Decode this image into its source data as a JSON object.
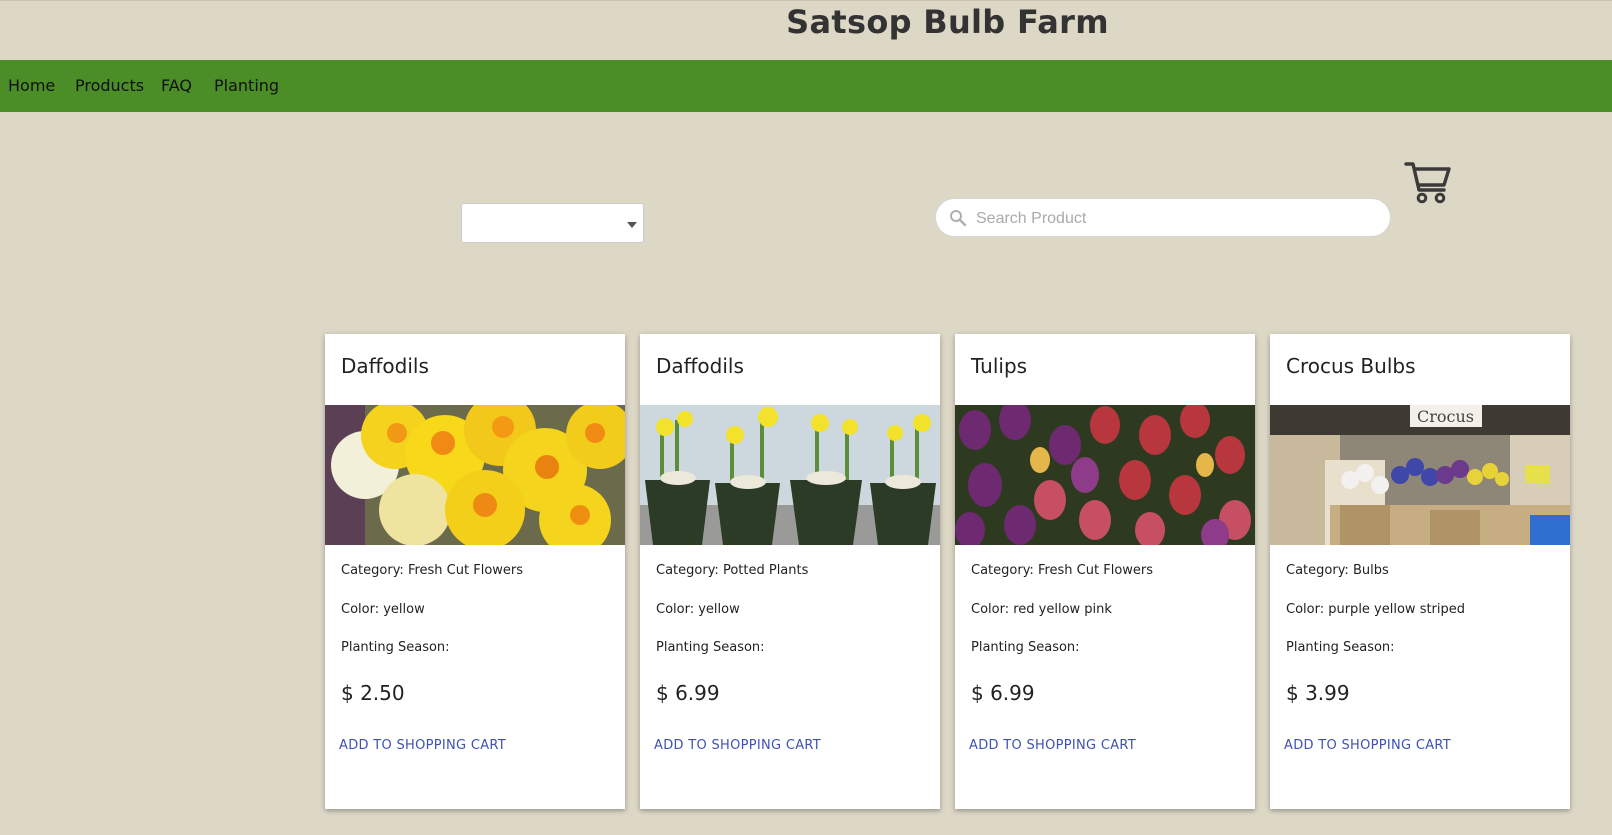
{
  "header": {
    "title": "Satsop Bulb Farm"
  },
  "nav": {
    "items": [
      "Home",
      "Products",
      "FAQ",
      "Planting"
    ]
  },
  "filters": {
    "category_select": {
      "selected": ""
    },
    "search": {
      "placeholder": "Search Product",
      "value": ""
    }
  },
  "icons": {
    "search": "search-icon",
    "cart": "shopping-cart-icon",
    "dropdown": "chevron-down-icon"
  },
  "colors": {
    "background": "#ddd7c6",
    "nav": "#4b8d27",
    "button_text": "#3f51b5"
  },
  "products": [
    {
      "title": "Daffodils",
      "category": "Category: Fresh Cut Flowers",
      "color": "Color: yellow",
      "season": "Planting Season:",
      "price": "$ 2.50",
      "button": "ADD TO SHOPPING CART"
    },
    {
      "title": "Daffodils",
      "category": "Category: Potted Plants",
      "color": "Color: yellow",
      "season": "Planting Season:",
      "price": "$ 6.99",
      "button": "ADD TO SHOPPING CART"
    },
    {
      "title": "Tulips",
      "category": "Category: Fresh Cut Flowers",
      "color": "Color: red yellow pink",
      "season": "Planting Season:",
      "price": "$ 6.99",
      "button": "ADD TO SHOPPING CART"
    },
    {
      "title": "Crocus Bulbs",
      "category": "Category: Bulbs",
      "color": "Color: purple yellow striped",
      "season": "Planting Season:",
      "price": "$ 3.99",
      "button": "ADD TO SHOPPING CART"
    }
  ],
  "images": {
    "sign_text": "Crocus"
  }
}
